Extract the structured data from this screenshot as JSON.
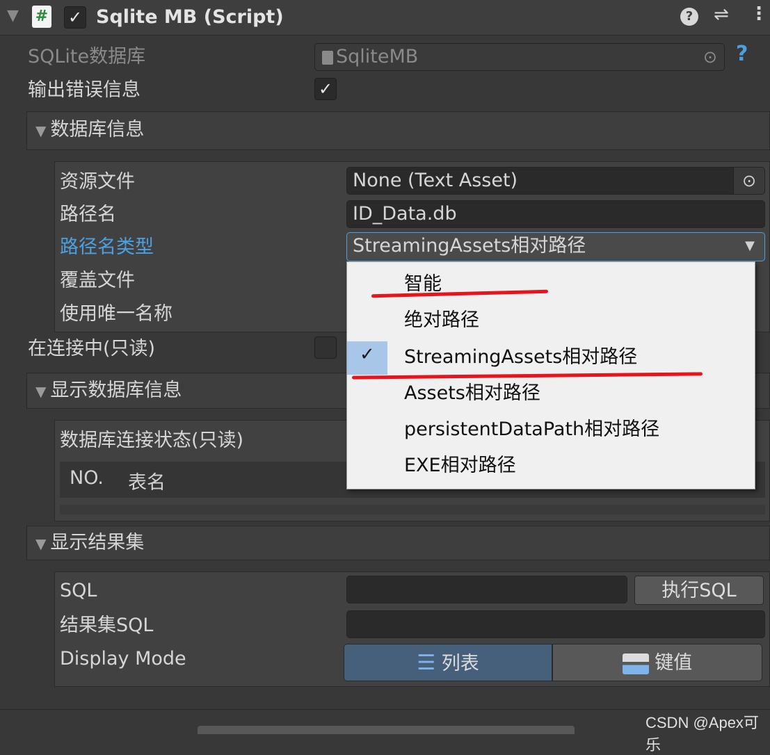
{
  "header": {
    "title": "Sqlite MB (Script)",
    "enabled_checked": true,
    "icons": [
      "collapse-arrow-icon",
      "script-hash-icon",
      "help-icon",
      "preset-sliders-icon",
      "kebab-menu-icon"
    ]
  },
  "fields": {
    "sqlite_db_label": "SQLite数据库",
    "sqlite_db_value": "SqliteMB",
    "output_error_label": "输出错误信息",
    "output_error_checked": true
  },
  "db_info": {
    "section_title": "数据库信息",
    "resource_file_label": "资源文件",
    "resource_file_value": "None (Text Asset)",
    "path_name_label": "路径名",
    "path_name_value": "ID_Data.db",
    "path_type_label": "路径名类型",
    "path_type_value": "StreamingAssets相对路径",
    "overwrite_label": "覆盖文件",
    "unique_name_label": "使用唯一名称"
  },
  "connecting_label": "在连接中(只读)",
  "show_db_info": {
    "section_title": "显示数据库信息",
    "status_label": "数据库连接状态(只读)",
    "col_no": "NO.",
    "col_table": "表名"
  },
  "show_result": {
    "section_title": "显示结果集",
    "sql_label": "SQL",
    "exec_button": "执行SQL",
    "result_sql_label": "结果集SQL",
    "display_mode_label": "Display Mode",
    "mode_list": "列表",
    "mode_kv": "键值"
  },
  "dropdown": {
    "options": [
      "智能",
      "绝对路径",
      "StreamingAssets相对路径",
      "Assets相对路径",
      "persistentDataPath相对路径",
      "EXE相对路径"
    ],
    "selected_index": 2
  },
  "watermark": "CSDN @Apex可乐",
  "colors": {
    "highlight_blue": "#4da0e0",
    "selected_mode": "#46607c",
    "annotation_red": "#e8141b"
  }
}
